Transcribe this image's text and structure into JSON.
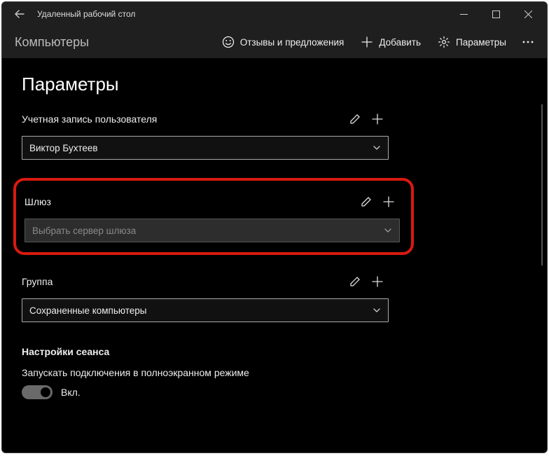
{
  "app": {
    "title": "Удаленный рабочий стол"
  },
  "cmdbar": {
    "title": "Компьютеры",
    "feedback": "Отзывы и предложения",
    "add": "Добавить",
    "settings": "Параметры"
  },
  "page": {
    "heading": "Параметры"
  },
  "user_account": {
    "label": "Учетная запись пользователя",
    "value": "Виктор Бухтеев"
  },
  "gateway": {
    "label": "Шлюз",
    "placeholder": "Выбрать сервер шлюза"
  },
  "group": {
    "label": "Группа",
    "value": "Сохраненные компьютеры"
  },
  "session": {
    "heading": "Настройки сеанса",
    "fullscreen_label": "Запускать подключения в полноэкранном режиме",
    "toggle_state": "Вкл."
  }
}
